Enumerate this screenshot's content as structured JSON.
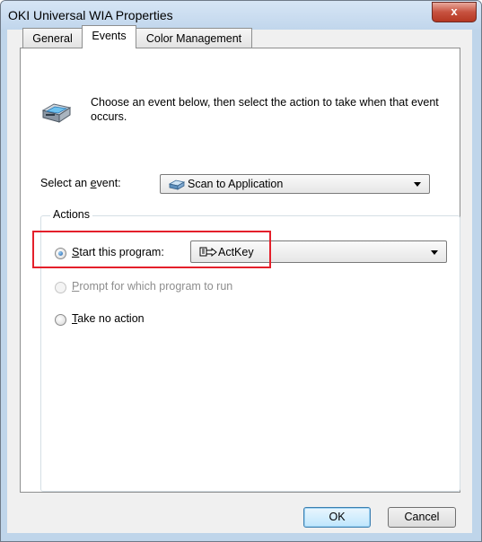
{
  "window": {
    "title": "OKI Universal WIA Properties",
    "close_glyph": "x"
  },
  "tabs": [
    {
      "label": "General",
      "active": false
    },
    {
      "label": "Events",
      "active": true
    },
    {
      "label": "Color Management",
      "active": false
    }
  ],
  "events_tab": {
    "description": "Choose an event below, then select the action to take when that event occurs.",
    "select_event": {
      "label_pre": "Select an ",
      "label_mnemonic": "e",
      "label_post": "vent:",
      "value": "Scan to Application",
      "icon": "scanner-event-icon"
    },
    "actions": {
      "legend": "Actions",
      "start_program": {
        "mnemonic": "S",
        "rest": "tart this program:",
        "checked": true,
        "program": "ActKey",
        "program_icon": "actkey-icon"
      },
      "prompt": {
        "mnemonic": "P",
        "rest": "rompt for which program to run",
        "enabled": false
      },
      "no_action": {
        "mnemonic": "T",
        "rest": "ake no action",
        "checked": false
      }
    }
  },
  "buttons": {
    "ok": "OK",
    "cancel": "Cancel"
  },
  "colors": {
    "highlight": "#e4202b",
    "titlebar": "#c1d6ec",
    "close": "#c7523f"
  }
}
